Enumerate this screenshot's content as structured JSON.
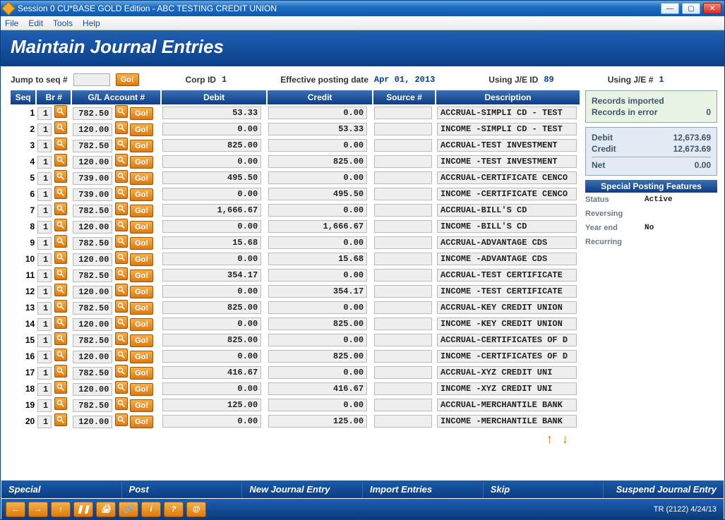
{
  "window": {
    "title": "Session 0 CU*BASE GOLD Edition - ABC TESTING CREDIT UNION"
  },
  "menu": {
    "file": "File",
    "edit": "Edit",
    "tools": "Tools",
    "help": "Help"
  },
  "page_title": "Maintain Journal Entries",
  "filters": {
    "jump_label": "Jump to seq #",
    "go_label": "Go!",
    "corp_id_label": "Corp ID",
    "corp_id": "1",
    "eff_label": "Effective posting date",
    "eff_date": "Apr 01, 2013",
    "je_id_label": "Using J/E ID",
    "je_id": "89",
    "je_num_label": "Using J/E #",
    "je_num": "1"
  },
  "columns": {
    "seq": "Seq",
    "br": "Br #",
    "gl": "G/L Account #",
    "debit": "Debit",
    "credit": "Credit",
    "source": "Source #",
    "desc": "Description"
  },
  "row_go_label": "Go!",
  "rows": [
    {
      "seq": "1",
      "br": "1",
      "gl": "782.50",
      "debit": "53.33",
      "credit": "0.00",
      "src": "",
      "desc": "ACCRUAL-SIMPLI CD - TEST"
    },
    {
      "seq": "2",
      "br": "1",
      "gl": "120.00",
      "debit": "0.00",
      "credit": "53.33",
      "src": "",
      "desc": "INCOME -SIMPLI CD - TEST"
    },
    {
      "seq": "3",
      "br": "1",
      "gl": "782.50",
      "debit": "825.00",
      "credit": "0.00",
      "src": "",
      "desc": "ACCRUAL-TEST INVESTMENT"
    },
    {
      "seq": "4",
      "br": "1",
      "gl": "120.00",
      "debit": "0.00",
      "credit": "825.00",
      "src": "",
      "desc": "INCOME -TEST INVESTMENT"
    },
    {
      "seq": "5",
      "br": "1",
      "gl": "739.00",
      "debit": "495.50",
      "credit": "0.00",
      "src": "",
      "desc": "ACCRUAL-CERTIFICATE CENCO"
    },
    {
      "seq": "6",
      "br": "1",
      "gl": "739.00",
      "debit": "0.00",
      "credit": "495.50",
      "src": "",
      "desc": "INCOME -CERTIFICATE CENCO"
    },
    {
      "seq": "7",
      "br": "1",
      "gl": "782.50",
      "debit": "1,666.67",
      "credit": "0.00",
      "src": "",
      "desc": "ACCRUAL-BILL'S CD"
    },
    {
      "seq": "8",
      "br": "1",
      "gl": "120.00",
      "debit": "0.00",
      "credit": "1,666.67",
      "src": "",
      "desc": "INCOME -BILL'S CD"
    },
    {
      "seq": "9",
      "br": "1",
      "gl": "782.50",
      "debit": "15.68",
      "credit": "0.00",
      "src": "",
      "desc": "ACCRUAL-ADVANTAGE CDS"
    },
    {
      "seq": "10",
      "br": "1",
      "gl": "120.00",
      "debit": "0.00",
      "credit": "15.68",
      "src": "",
      "desc": "INCOME -ADVANTAGE CDS"
    },
    {
      "seq": "11",
      "br": "1",
      "gl": "782.50",
      "debit": "354.17",
      "credit": "0.00",
      "src": "",
      "desc": "ACCRUAL-TEST CERTIFICATE"
    },
    {
      "seq": "12",
      "br": "1",
      "gl": "120.00",
      "debit": "0.00",
      "credit": "354.17",
      "src": "",
      "desc": "INCOME -TEST CERTIFICATE"
    },
    {
      "seq": "13",
      "br": "1",
      "gl": "782.50",
      "debit": "825.00",
      "credit": "0.00",
      "src": "",
      "desc": "ACCRUAL-KEY CREDIT UNION"
    },
    {
      "seq": "14",
      "br": "1",
      "gl": "120.00",
      "debit": "0.00",
      "credit": "825.00",
      "src": "",
      "desc": "INCOME -KEY CREDIT UNION"
    },
    {
      "seq": "15",
      "br": "1",
      "gl": "782.50",
      "debit": "825.00",
      "credit": "0.00",
      "src": "",
      "desc": "ACCRUAL-CERTIFICATES OF D"
    },
    {
      "seq": "16",
      "br": "1",
      "gl": "120.00",
      "debit": "0.00",
      "credit": "825.00",
      "src": "",
      "desc": "INCOME -CERTIFICATES OF D"
    },
    {
      "seq": "17",
      "br": "1",
      "gl": "782.50",
      "debit": "416.67",
      "credit": "0.00",
      "src": "",
      "desc": "ACCRUAL-XYZ CREDIT UNI"
    },
    {
      "seq": "18",
      "br": "1",
      "gl": "120.00",
      "debit": "0.00",
      "credit": "416.67",
      "src": "",
      "desc": "INCOME -XYZ CREDIT UNI"
    },
    {
      "seq": "19",
      "br": "1",
      "gl": "782.50",
      "debit": "125.00",
      "credit": "0.00",
      "src": "",
      "desc": "ACCRUAL-MERCHANTILE BANK"
    },
    {
      "seq": "20",
      "br": "1",
      "gl": "120.00",
      "debit": "0.00",
      "credit": "125.00",
      "src": "",
      "desc": "INCOME -MERCHANTILE BANK"
    }
  ],
  "import_panel": {
    "imported_label": "Records imported",
    "imported": "",
    "error_label": "Records in error",
    "error": "0"
  },
  "totals": {
    "debit_label": "Debit",
    "debit": "12,673.69",
    "credit_label": "Credit",
    "credit": "12,673.69",
    "net_label": "Net",
    "net": "0.00"
  },
  "features_hdr": "Special Posting Features",
  "features": {
    "status_label": "Status",
    "status": "Active",
    "reversing_label": "Reversing",
    "reversing": "",
    "yearend_label": "Year end",
    "yearend": "No",
    "recurring_label": "Recurring",
    "recurring": ""
  },
  "footer": {
    "special": "Special",
    "post": "Post",
    "new": "New Journal Entry",
    "import": "Import Entries",
    "skip": "Skip",
    "suspend": "Suspend Journal Entry"
  },
  "status_bar": "TR (2122) 4/24/13"
}
